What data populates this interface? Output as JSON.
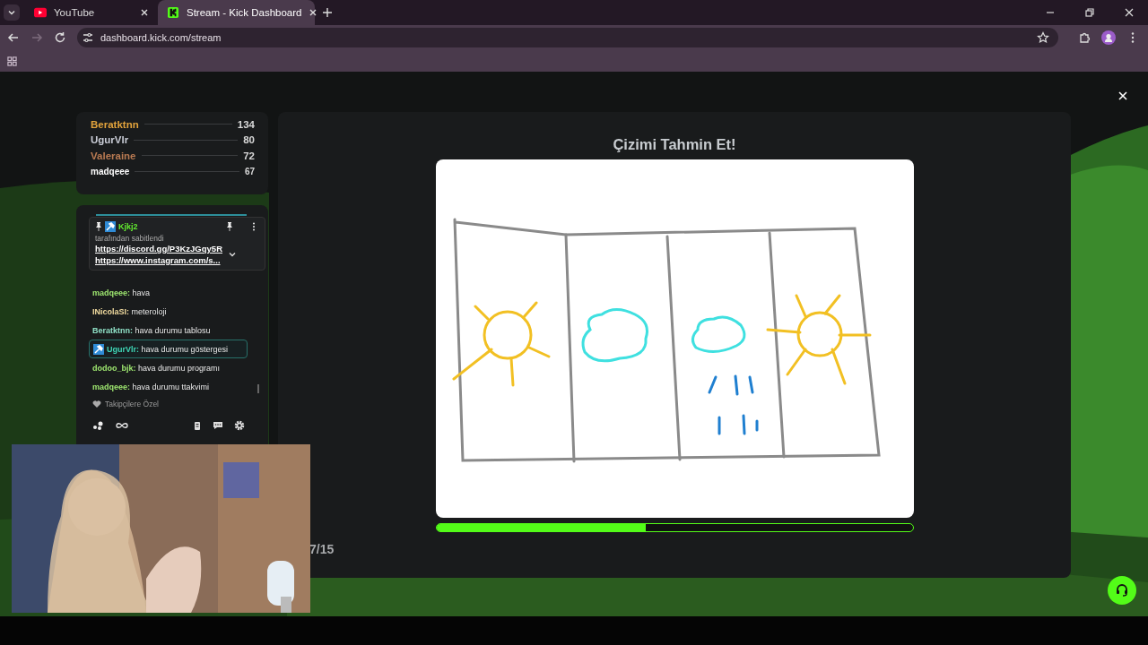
{
  "browser": {
    "tabs": [
      {
        "title": "YouTube",
        "kind": "youtube",
        "selected": false
      },
      {
        "title": "Stream - Kick Dashboard",
        "kind": "kick",
        "selected": true
      }
    ],
    "address": "dashboard.kick.com/stream"
  },
  "leaderboard": [
    {
      "name": "Beratktnn",
      "score": "134",
      "color": "#e2a33c"
    },
    {
      "name": "UgurVlr",
      "score": "80",
      "color": "#c9ccd6"
    },
    {
      "name": "Valeraine",
      "score": "72",
      "color": "#b97a52"
    },
    {
      "name": "madqeee",
      "score": "67",
      "color": "#ffffff"
    }
  ],
  "chat": {
    "pinned": {
      "user": "Kjkj2",
      "note": "tarafından sabitlendi",
      "links": [
        "https://discord.gg/P3KzJGqy5R",
        "https://www.instagram.com/s..."
      ]
    },
    "messages": [
      {
        "user": "madqeee:",
        "text": "hava",
        "color": "#9fe870",
        "badge": false,
        "highlighted": false
      },
      {
        "user": "INicolaSI:",
        "text": "meteroloji",
        "color": "#f2dca0",
        "badge": false,
        "highlighted": false
      },
      {
        "user": "Beratktnn:",
        "text": "hava durumu tablosu",
        "color": "#8fe0c6",
        "badge": false,
        "highlighted": false
      },
      {
        "user": "UgurVlr:",
        "text": "hava durumu göstergesi",
        "color": "#3fd6b6",
        "badge": true,
        "highlighted": true
      },
      {
        "user": "dodoo_bjk:",
        "text": "hava durumu programı",
        "color": "#9fe870",
        "badge": false,
        "highlighted": false
      },
      {
        "user": "madqeee:",
        "text": "hava durumu ttakvimi",
        "color": "#9fe870",
        "badge": false,
        "highlighted": false
      }
    ],
    "mode": "Takipçilere Özel"
  },
  "game": {
    "title": "Çizimi Tahmin Et!",
    "progress": {
      "level": 0.44
    },
    "counter": "7/15"
  }
}
